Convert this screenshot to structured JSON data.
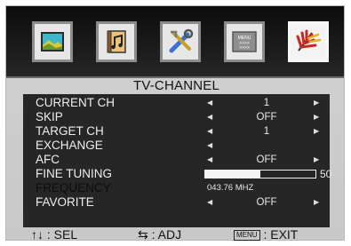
{
  "menu_tabs": [
    {
      "name": "picture",
      "icon": "picture-icon"
    },
    {
      "name": "audio",
      "icon": "music-icon"
    },
    {
      "name": "setup",
      "icon": "tools-icon"
    },
    {
      "name": "menu",
      "icon": "menu-icon",
      "text": "MENU\n>>>>\n>>>>"
    },
    {
      "name": "channel",
      "icon": "antenna-icon",
      "selected": true
    }
  ],
  "panel": {
    "title": "TV-CHANNEL",
    "rows": [
      {
        "label": "CURRENT CH",
        "value": "1"
      },
      {
        "label": "SKIP",
        "value": "OFF"
      },
      {
        "label": "TARGET CH",
        "value": "1"
      },
      {
        "label": "EXCHANGE"
      },
      {
        "label": "AFC",
        "value": "OFF"
      },
      {
        "label": "FINE TUNING",
        "value": "50",
        "level": 0.5
      },
      {
        "label": "FREQUENCY",
        "value": "043.76 MHZ"
      },
      {
        "label": "FAVORITE",
        "value": "OFF"
      }
    ]
  },
  "footer": {
    "sel": "↑↓ : SEL",
    "adj": "⇆ : ADJ",
    "menu_key": "MENU",
    "exit": " : EXIT"
  },
  "colors": {
    "panel_bg": "#262626",
    "frame": "#cccccc",
    "topbar": "#141414"
  }
}
